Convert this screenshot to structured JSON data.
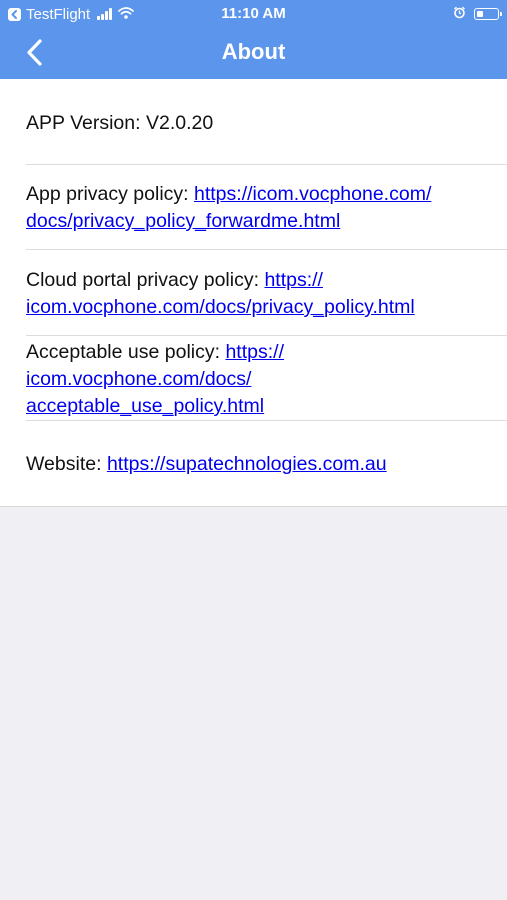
{
  "status_bar": {
    "back_app": "TestFlight",
    "time": "11:10 AM"
  },
  "nav": {
    "title": "About"
  },
  "about": {
    "app_version": "APP Version: V2.0.20",
    "app_privacy_label": "App privacy policy: ",
    "app_privacy_url_line1": "https://icom.vocphone.com/",
    "app_privacy_url_line2": "docs/privacy_policy_forwardme.html",
    "cloud_privacy_label": "Cloud portal privacy policy: ",
    "cloud_privacy_url_line1": "https://",
    "cloud_privacy_url_line2": "icom.vocphone.com/docs/privacy_policy.html",
    "acceptable_use_label": "Acceptable use policy: ",
    "acceptable_use_url_line1": "https://",
    "acceptable_use_url_line2": "icom.vocphone.com/docs/",
    "acceptable_use_url_line3": "acceptable_use_policy.html",
    "website_label": "Website: ",
    "website_url": "https://supatechnologies.com.au"
  },
  "colors": {
    "header_bg": "#5b95ec",
    "link": "#0000ee",
    "page_bg": "#efeff4"
  }
}
